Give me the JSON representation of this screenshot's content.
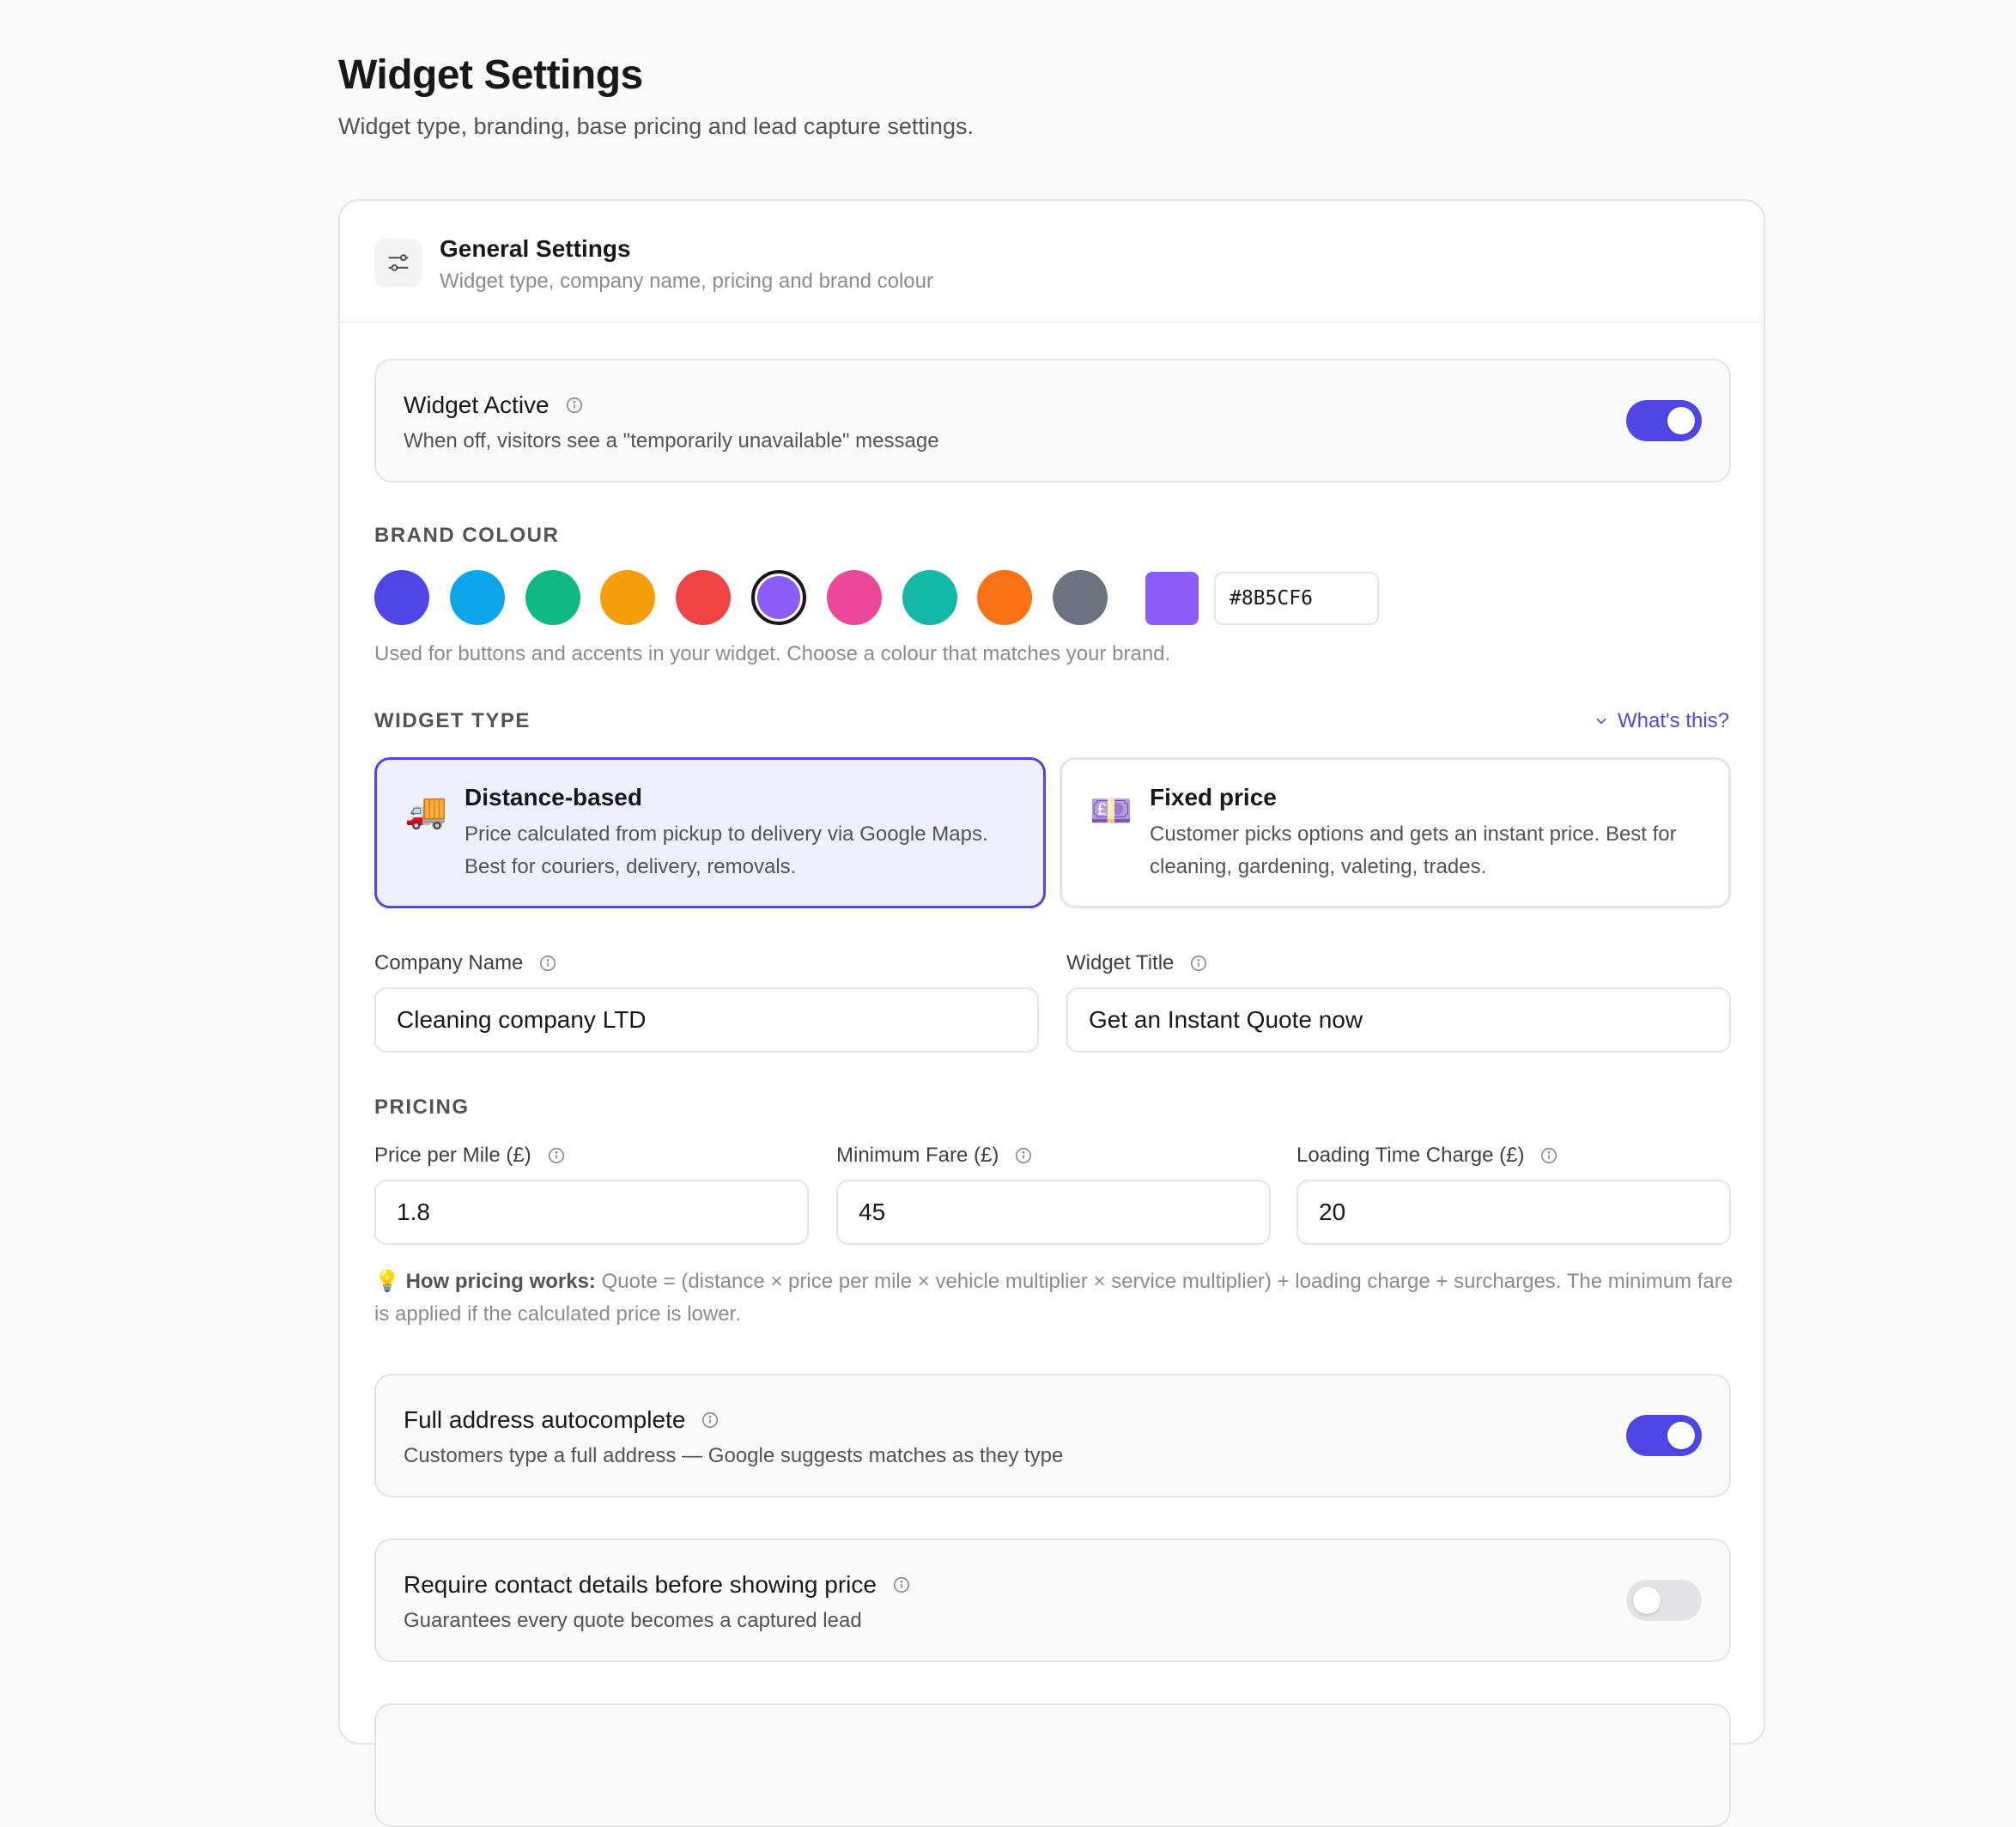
{
  "page": {
    "title": "Widget Settings",
    "subtitle": "Widget type, branding, base pricing and lead capture settings."
  },
  "general": {
    "title": "General Settings",
    "subtitle": "Widget type, company name, pricing and brand colour",
    "icon": "sliders-icon"
  },
  "widget_active": {
    "title": "Widget Active",
    "description": "When off, visitors see a \"temporarily unavailable\" message",
    "enabled": true
  },
  "brand_colour": {
    "label": "BRAND COLOUR",
    "swatches": [
      "#4f46e5",
      "#0ea5e9",
      "#10b981",
      "#f59e0b",
      "#ef4444",
      "#8b5cf6",
      "#ec4899",
      "#14b8a6",
      "#f97316",
      "#6b7280"
    ],
    "selected_index": 5,
    "hex_value": "#8B5CF6",
    "preview_color": "#8b5cf6",
    "help": "Used for buttons and accents in your widget. Choose a colour that matches your brand."
  },
  "widget_type": {
    "label": "WIDGET TYPE",
    "whats_this": "What's this?",
    "options": [
      {
        "emoji": "🚚",
        "title": "Distance-based",
        "description": "Price calculated from pickup to delivery via Google Maps. Best for couriers, delivery, removals.",
        "selected": true
      },
      {
        "emoji": "💷",
        "title": "Fixed price",
        "description": "Customer picks options and gets an instant price. Best for cleaning, gardening, valeting, trades.",
        "selected": false
      }
    ]
  },
  "company": {
    "company_name_label": "Company Name",
    "company_name_value": "Cleaning company LTD",
    "widget_title_label": "Widget Title",
    "widget_title_value": "Get an Instant Quote now"
  },
  "pricing": {
    "label": "PRICING",
    "price_per_mile_label": "Price per Mile (£)",
    "price_per_mile_value": "1.8",
    "minimum_fare_label": "Minimum Fare (£)",
    "minimum_fare_value": "45",
    "loading_charge_label": "Loading Time Charge (£)",
    "loading_charge_value": "20",
    "note_emoji": "💡",
    "note_heading": "How pricing works:",
    "note_text": "Quote = (distance × price per mile × vehicle multiplier × service multiplier) + loading charge + surcharges. The minimum fare is applied if the calculated price is lower."
  },
  "autocomplete": {
    "title": "Full address autocomplete",
    "description": "Customers type a full address — Google suggests matches as they type",
    "enabled": true
  },
  "require_contact": {
    "title": "Require contact details before showing price",
    "description": "Guarantees every quote becomes a captured lead",
    "enabled": false
  }
}
